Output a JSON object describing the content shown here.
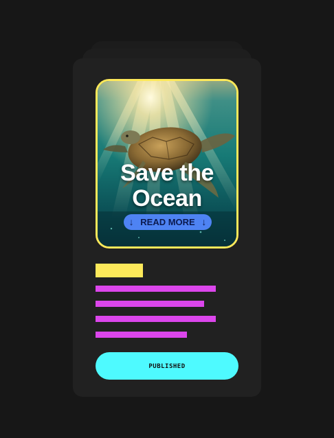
{
  "hero": {
    "title_line1": "Save the",
    "title_line2": "Ocean",
    "cta_label": "READ MORE",
    "cta_arrow": "↓",
    "image_subject": "sea-turtle-underwater-sun-rays"
  },
  "status": {
    "label": "PUBLISHED"
  },
  "colors": {
    "page_background": "#171717",
    "card_background": "#212121",
    "accent_yellow": "#fde95a",
    "accent_magenta": "#dc46ec",
    "accent_cyan": "#4efaff",
    "cta_blue": "#4e83f3"
  }
}
